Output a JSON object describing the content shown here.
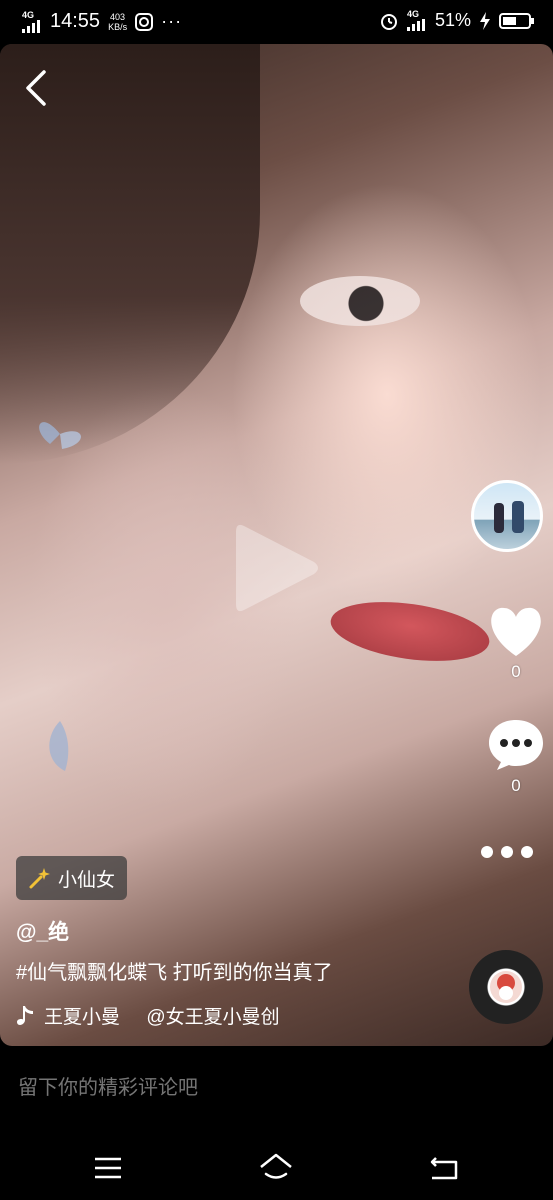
{
  "status_bar": {
    "signal_label": "4G",
    "time": "14:55",
    "speed_value": "403",
    "speed_unit": "KB/s",
    "more": "···",
    "network_label": "4G",
    "battery_percent": "51%"
  },
  "video": {
    "play_state": "paused"
  },
  "side_actions": {
    "likes": "0",
    "comments": "0"
  },
  "tag": {
    "label": "小仙女"
  },
  "post": {
    "author": "@_绝",
    "description": "#仙气飘飘化蝶飞 打听到的你当真了",
    "music_text": "王夏小曼     @女王夏小曼创"
  },
  "comment": {
    "placeholder": "留下你的精彩评论吧"
  },
  "icons": [
    "back-icon",
    "play-icon",
    "heart-icon",
    "comment-icon",
    "more-icon",
    "music-note-icon",
    "wand-icon",
    "menu-icon",
    "home-icon",
    "return-icon"
  ],
  "colors": {
    "lips": "#c8343e",
    "tag_bg": "#3c3c3c",
    "background": "#000000"
  }
}
